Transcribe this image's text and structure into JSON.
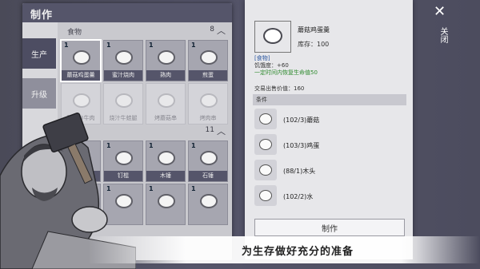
{
  "craft": {
    "title": "制作",
    "tabs": [
      "生产",
      "升级"
    ],
    "food_section": {
      "label": "食物",
      "count": "8"
    },
    "tools_section": {
      "count": "11"
    },
    "food_items": [
      {
        "qty": "1",
        "name": "蘑菇鸡蛋羹",
        "dim": false,
        "selected": true
      },
      {
        "qty": "1",
        "name": "蜜汁烧肉",
        "dim": false,
        "selected": false
      },
      {
        "qty": "1",
        "name": "熟肉",
        "dim": false,
        "selected": false
      },
      {
        "qty": "1",
        "name": "煎蛋",
        "dim": false,
        "selected": false
      },
      {
        "qty": "",
        "name": "菠菜炒牛肉",
        "dim": true,
        "selected": false
      },
      {
        "qty": "",
        "name": "烧汁牛蛙腿",
        "dim": true,
        "selected": false
      },
      {
        "qty": "",
        "name": "烤蘑菇串",
        "dim": true,
        "selected": false
      },
      {
        "qty": "",
        "name": "烤肉串",
        "dim": true,
        "selected": false
      }
    ],
    "tool_items": [
      {
        "qty": "1",
        "name": "木棍"
      },
      {
        "qty": "1",
        "name": "钉棍"
      },
      {
        "qty": "1",
        "name": "木锤"
      },
      {
        "qty": "1",
        "name": "石锤"
      },
      {
        "qty": "",
        "name": ""
      },
      {
        "qty": "1",
        "name": ""
      },
      {
        "qty": "1",
        "name": ""
      },
      {
        "qty": "1",
        "name": ""
      }
    ]
  },
  "detail": {
    "item_name": "蘑菇鸡蛋羹",
    "stock": "库存：100",
    "category": "[食物]",
    "effect1": "饥饿度：+60",
    "effect2": "一定时间内恢复生命值50",
    "price": "交易出售价值：160",
    "req_header": "条件",
    "requirements": [
      {
        "text": "(102/3)蘑菇"
      },
      {
        "text": "(103/3)鸡蛋"
      },
      {
        "text": "(88/1)木头"
      },
      {
        "text": "(102/2)水"
      }
    ],
    "craft_button": "制作"
  },
  "close": {
    "label": "关闭"
  },
  "banner": {
    "text": "为生存做好充分的准备"
  }
}
